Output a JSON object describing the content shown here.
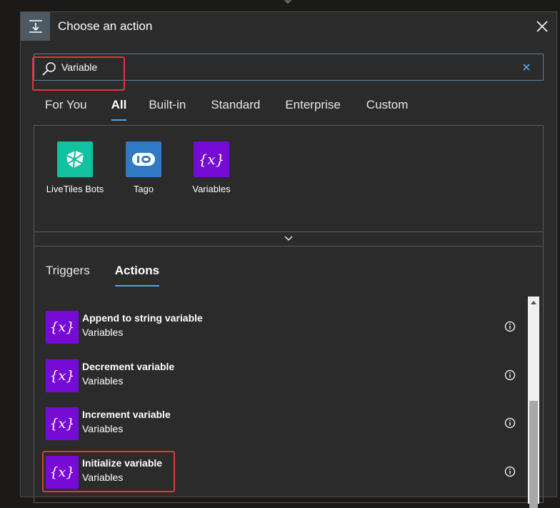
{
  "header": {
    "title": "Choose an action",
    "icon": "insert-step-icon",
    "close_icon": "close-icon"
  },
  "search": {
    "value": "Variable",
    "placeholder": "",
    "icon": "search-icon",
    "clear_icon": "clear-icon"
  },
  "tabs": [
    {
      "label": "For You",
      "active": false
    },
    {
      "label": "All",
      "active": true
    },
    {
      "label": "Built-in",
      "active": false
    },
    {
      "label": "Standard",
      "active": false
    },
    {
      "label": "Enterprise",
      "active": false
    },
    {
      "label": "Custom",
      "active": false
    }
  ],
  "connectors": [
    {
      "label": "LiveTiles Bots",
      "icon": "livetiles-bots-icon",
      "color": "#13c1a0"
    },
    {
      "label": "Tago",
      "icon": "tago-icon",
      "color": "#2f7ac3"
    },
    {
      "label": "Variables",
      "icon": "variables-icon",
      "color": "#770bd6"
    }
  ],
  "subtabs": [
    {
      "label": "Triggers",
      "active": false
    },
    {
      "label": "Actions",
      "active": true
    }
  ],
  "actions": [
    {
      "title": "Append to string variable",
      "connector": "Variables",
      "icon": "variables-icon"
    },
    {
      "title": "Decrement variable",
      "connector": "Variables",
      "icon": "variables-icon"
    },
    {
      "title": "Increment variable",
      "connector": "Variables",
      "icon": "variables-icon"
    },
    {
      "title": "Initialize variable",
      "connector": "Variables",
      "icon": "variables-icon"
    }
  ],
  "colors": {
    "accent": "#5aa0e6",
    "highlight": "#e0363a",
    "variables": "#770bd6"
  }
}
